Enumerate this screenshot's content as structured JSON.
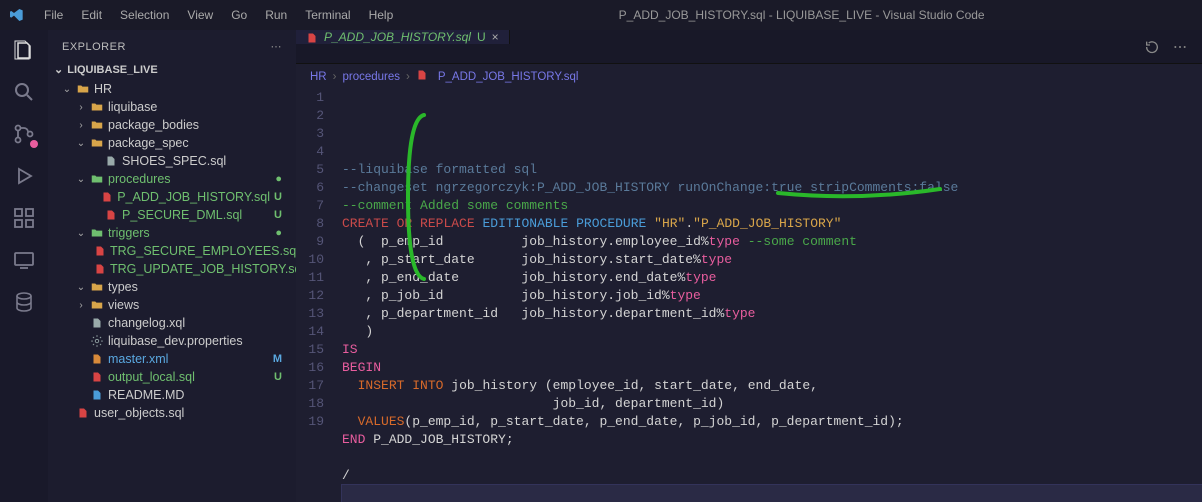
{
  "titlebar": {
    "menus": [
      "File",
      "Edit",
      "Selection",
      "View",
      "Go",
      "Run",
      "Terminal",
      "Help"
    ],
    "title": "P_ADD_JOB_HISTORY.sql - LIQUIBASE_LIVE - Visual Studio Code"
  },
  "activitybar": {
    "items": [
      {
        "name": "files-icon",
        "active": true
      },
      {
        "name": "search-icon"
      },
      {
        "name": "source-control-icon",
        "badge": true
      },
      {
        "name": "debug-icon"
      },
      {
        "name": "extensions-icon"
      },
      {
        "name": "remote-icon"
      },
      {
        "name": "database-icon"
      }
    ]
  },
  "sidebar": {
    "header": "EXPLORER",
    "section": "LIQUIBASE_LIVE",
    "tree": [
      {
        "depth": 1,
        "chev": "⌄",
        "icon": "folder",
        "iconClass": "folder-icon",
        "label": "HR",
        "labelClass": ""
      },
      {
        "depth": 2,
        "chev": "›",
        "icon": "folder",
        "iconClass": "folder-icon",
        "label": "liquibase",
        "labelClass": ""
      },
      {
        "depth": 2,
        "chev": "›",
        "icon": "folder",
        "iconClass": "folder-icon",
        "label": "package_bodies",
        "labelClass": ""
      },
      {
        "depth": 2,
        "chev": "⌄",
        "icon": "folder",
        "iconClass": "folder-icon",
        "label": "package_spec",
        "labelClass": ""
      },
      {
        "depth": 3,
        "chev": "",
        "icon": "file",
        "iconClass": "file-gray",
        "label": "SHOES_SPEC.sql",
        "labelClass": ""
      },
      {
        "depth": 2,
        "chev": "⌄",
        "icon": "folder",
        "iconClass": "folder-green",
        "label": "procedures",
        "labelClass": "label-green",
        "badge": "●",
        "badgeClass": "badge-dot"
      },
      {
        "depth": 3,
        "chev": "",
        "icon": "file",
        "iconClass": "file-red",
        "label": "P_ADD_JOB_HISTORY.sql",
        "labelClass": "label-green",
        "badge": "U",
        "badgeClass": "badge-U"
      },
      {
        "depth": 3,
        "chev": "",
        "icon": "file",
        "iconClass": "file-red",
        "label": "P_SECURE_DML.sql",
        "labelClass": "label-green",
        "badge": "U",
        "badgeClass": "badge-U"
      },
      {
        "depth": 2,
        "chev": "⌄",
        "icon": "folder",
        "iconClass": "folder-green",
        "label": "triggers",
        "labelClass": "label-green",
        "badge": "●",
        "badgeClass": "badge-dot"
      },
      {
        "depth": 3,
        "chev": "",
        "icon": "file",
        "iconClass": "file-red",
        "label": "TRG_SECURE_EMPLOYEES.sql",
        "labelClass": "label-green",
        "badge": "U",
        "badgeClass": "badge-U"
      },
      {
        "depth": 3,
        "chev": "",
        "icon": "file",
        "iconClass": "file-red",
        "label": "TRG_UPDATE_JOB_HISTORY.sql",
        "labelClass": "label-green",
        "badge": "U",
        "badgeClass": "badge-U"
      },
      {
        "depth": 2,
        "chev": "⌄",
        "icon": "folder",
        "iconClass": "folder-icon",
        "label": "types",
        "labelClass": ""
      },
      {
        "depth": 2,
        "chev": "›",
        "icon": "folder",
        "iconClass": "folder-icon",
        "label": "views",
        "labelClass": ""
      },
      {
        "depth": 2,
        "chev": "",
        "icon": "file",
        "iconClass": "file-gray",
        "label": "changelog.xql",
        "labelClass": ""
      },
      {
        "depth": 2,
        "chev": "",
        "icon": "gear",
        "iconClass": "file-gray",
        "label": "liquibase_dev.properties",
        "labelClass": ""
      },
      {
        "depth": 2,
        "chev": "",
        "icon": "file",
        "iconClass": "file-orange",
        "label": "master.xml",
        "labelClass": "label-blue",
        "badge": "M",
        "badgeClass": "badge-M"
      },
      {
        "depth": 2,
        "chev": "",
        "icon": "file",
        "iconClass": "file-red",
        "label": "output_local.sql",
        "labelClass": "label-green",
        "badge": "U",
        "badgeClass": "badge-U"
      },
      {
        "depth": 2,
        "chev": "",
        "icon": "file",
        "iconClass": "file-blue",
        "label": "README.MD",
        "labelClass": ""
      },
      {
        "depth": 1,
        "chev": "",
        "icon": "file",
        "iconClass": "file-red",
        "label": "user_objects.sql",
        "labelClass": ""
      }
    ]
  },
  "tabs": {
    "open": [
      {
        "icon": "file-red",
        "label": "P_ADD_JOB_HISTORY.sql",
        "modified": "U"
      }
    ]
  },
  "breadcrumbs": {
    "parts": [
      "HR",
      "procedures",
      "P_ADD_JOB_HISTORY.sql"
    ]
  },
  "code": {
    "lines": [
      {
        "n": 1,
        "html": "<span class='c-comment'>--liquibase formatted sql</span>"
      },
      {
        "n": 2,
        "html": "<span class='c-comment'>--changeset ngrzegorczyk:P_ADD_JOB_HISTORY runOnChange:true stripComments:false</span>"
      },
      {
        "n": 3,
        "html": "<span class='c-green'>--comment Added some comments</span>"
      },
      {
        "n": 4,
        "html": "<span class='c-key'>CREATE</span> <span class='c-key'>OR</span> <span class='c-key'>REPLACE</span> <span class='c-blue'>EDITIONABLE</span> <span class='c-blue'>PROCEDURE</span> <span class='c-str'>\"HR\"</span>.<span class='c-str'>\"P_ADD_JOB_HISTORY\"</span>"
      },
      {
        "n": 5,
        "html": "  <span class='c-white'>(  p_emp_id          job_history.employee_id%</span><span class='c-pink'>type</span> <span class='c-green'>--some comment</span>"
      },
      {
        "n": 6,
        "html": "   <span class='c-white'>, p_start_date      job_history.start_date%</span><span class='c-pink'>type</span>"
      },
      {
        "n": 7,
        "html": "   <span class='c-white'>, p_end_date        job_history.end_date%</span><span class='c-pink'>type</span>"
      },
      {
        "n": 8,
        "html": "   <span class='c-white'>, p_job_id          job_history.job_id%</span><span class='c-pink'>type</span>"
      },
      {
        "n": 9,
        "html": "   <span class='c-white'>, p_department_id   job_history.department_id%</span><span class='c-pink'>type</span>"
      },
      {
        "n": 10,
        "html": "   <span class='c-white'>)</span>"
      },
      {
        "n": 11,
        "html": "<span class='c-pink'>IS</span>"
      },
      {
        "n": 12,
        "html": "<span class='c-pink'>BEGIN</span>"
      },
      {
        "n": 13,
        "html": "  <span class='c-key2'>INSERT</span> <span class='c-key2'>INTO</span> <span class='c-white'>job_history (employee_id, start_date, end_date,</span>"
      },
      {
        "n": 14,
        "html": "                           <span class='c-white'>job_id, department_id)</span>"
      },
      {
        "n": 15,
        "html": "  <span class='c-key2'>VALUES</span><span class='c-white'>(p_emp_id, p_start_date, p_end_date, p_job_id, p_department_id);</span>"
      },
      {
        "n": 16,
        "html": "<span class='c-pink'>END</span> <span class='c-white'>P_ADD_JOB_HISTORY;</span>"
      },
      {
        "n": 17,
        "html": ""
      },
      {
        "n": 18,
        "html": "<span class='c-white'>/</span>"
      },
      {
        "n": 19,
        "html": "",
        "cursor": true
      }
    ]
  }
}
